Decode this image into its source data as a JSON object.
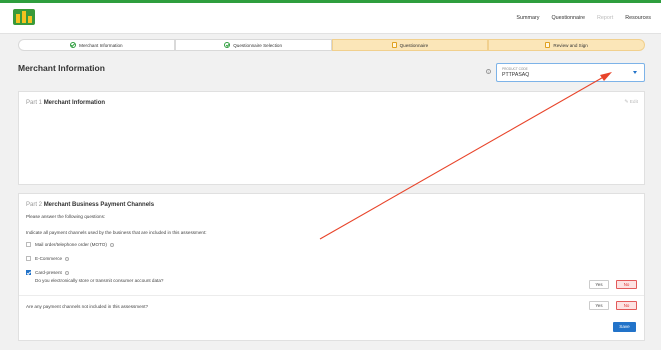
{
  "nav": {
    "items": [
      {
        "label": "Summary",
        "muted": false
      },
      {
        "label": "Questionnaire",
        "muted": false
      },
      {
        "label": "Report",
        "muted": true
      },
      {
        "label": "Resources",
        "muted": false
      }
    ]
  },
  "steps": [
    {
      "label": "Merchant Information",
      "status": "done"
    },
    {
      "label": "Questionnaire Selection",
      "status": "done"
    },
    {
      "label": "Questionnaire",
      "status": "todo"
    },
    {
      "label": "Review and Sign",
      "status": "todo"
    }
  ],
  "page": {
    "title": "Merchant Information",
    "product": {
      "label": "PRODUCT CODE",
      "value": "PTTPASAQ"
    }
  },
  "part1": {
    "prefix": "Part 1",
    "title": "Merchant Information",
    "edit_label": "Edit"
  },
  "part2": {
    "prefix": "Part 2",
    "title": "Merchant Business Payment Channels",
    "intro": "Please answer the following questions:",
    "indicate": "Indicate all payment channels used by the business that are included in this assessment:",
    "channels": [
      {
        "label": "Mail order/telephone order (MOTO)",
        "checked": false
      },
      {
        "label": "E-Commerce",
        "checked": false
      },
      {
        "label": "Card-present",
        "checked": true
      }
    ],
    "q1": "Do you electronically store or transmit consumer account data?",
    "q2": "Are any payment channels not included in this assessment?",
    "yes_label": "Yes",
    "no_label": "No",
    "save_label": "Save"
  },
  "colors": {
    "brand_green": "#2e9e3e",
    "accent_blue": "#2273c9",
    "step_pending": "#fbe6b8",
    "no_red": "#e35a5a",
    "annotation_arrow": "#e8442a"
  }
}
